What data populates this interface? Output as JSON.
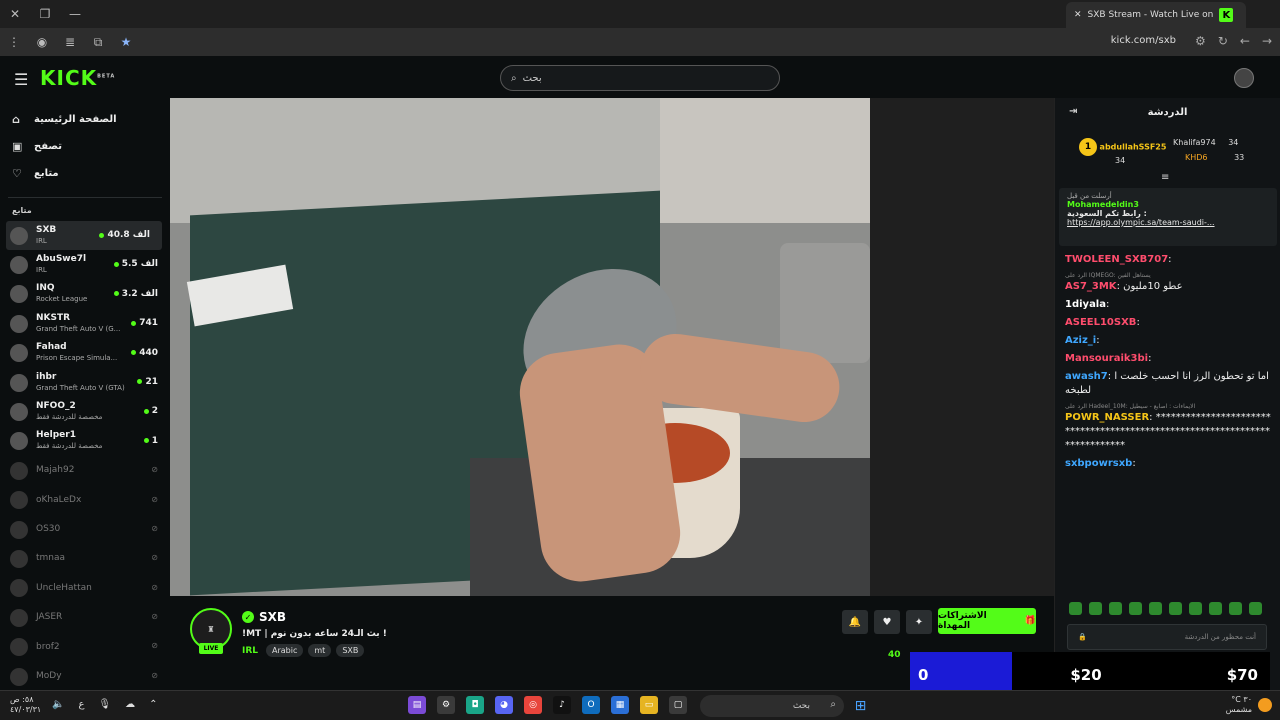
{
  "browser": {
    "tab_title": "SXB Stream - Watch Live on",
    "tab_favicon": "K",
    "url": "kick.com/sxb"
  },
  "header": {
    "logo": "KICK",
    "logo_badge": "BETA",
    "search_placeholder": "بحث"
  },
  "sidebar": {
    "nav": [
      {
        "label": "الصفحة الرئيسية",
        "icon": "home-icon"
      },
      {
        "label": "تصفح",
        "icon": "browse-icon"
      },
      {
        "label": "متابع",
        "icon": "heart-icon"
      }
    ],
    "section_title": "متابع",
    "channels": [
      {
        "name": "SXB",
        "category": "IRL",
        "viewers": "الف 40.8",
        "live": true
      },
      {
        "name": "AbuSwe7l",
        "category": "IRL",
        "viewers": "الف 5.5",
        "live": true
      },
      {
        "name": "INQ",
        "category": "Rocket League",
        "viewers": "الف 3.2",
        "live": true
      },
      {
        "name": "NKSTR",
        "category": "Grand Theft Auto V (G...",
        "viewers": "741",
        "live": true
      },
      {
        "name": "Fahad",
        "category": "Prison Escape Simula...",
        "viewers": "440",
        "live": true
      },
      {
        "name": "ihbr",
        "category": "Grand Theft Auto V (GTA)",
        "viewers": "21",
        "live": true
      },
      {
        "name": "NFOO_2",
        "category": "مخصصة للدردشة فقط",
        "viewers": "2",
        "live": true
      },
      {
        "name": "Helper1",
        "category": "مخصصة للدردشة فقط",
        "viewers": "1",
        "live": true
      },
      {
        "name": "Majah92",
        "category": "",
        "viewers": "",
        "live": false
      },
      {
        "name": "oKhaLeDx",
        "category": "",
        "viewers": "",
        "live": false
      },
      {
        "name": "OS30",
        "category": "",
        "viewers": "",
        "live": false
      },
      {
        "name": "tmnaa",
        "category": "",
        "viewers": "",
        "live": false
      },
      {
        "name": "UncleHattan",
        "category": "",
        "viewers": "",
        "live": false
      },
      {
        "name": "JASER",
        "category": "",
        "viewers": "",
        "live": false
      },
      {
        "name": "brof2",
        "category": "",
        "viewers": "",
        "live": false
      },
      {
        "name": "MoDy",
        "category": "",
        "viewers": "",
        "live": false
      }
    ]
  },
  "stream": {
    "channel": "SXB",
    "live_label": "LIVE",
    "title": "!MT | بث الـ24 ساعه بدون نوم !",
    "category": "IRL",
    "tags": [
      "Arabic",
      "mt",
      "SXB"
    ],
    "gift_button": "الاشتراكات المهداة",
    "viewer_count": "40"
  },
  "chat": {
    "title": "الدردشة",
    "leaderboard": [
      {
        "rank": "1",
        "name": "abdullahSSF25",
        "count": "34"
      },
      {
        "name": "Khalifa974",
        "count": "34"
      },
      {
        "name": "KHD6",
        "count": "33"
      }
    ],
    "pinned": {
      "label": "أرسلت من قبل",
      "user": "Mohamedeldin3",
      "text": "رابط تكم السعودية :",
      "link": "https://app.olympic.sa/team-saudi-..."
    },
    "messages": [
      {
        "user": "TWOLEEN_SXB707",
        "text": ":",
        "color": "#ff4d6d"
      },
      {
        "reply": "الرد على IQMEGO: يستاهل الفين",
        "user": "AS7_3MK",
        "text": ": عطو 10مليون",
        "color": "#ff4d6d"
      },
      {
        "user": "1diyala",
        "text": ":",
        "color": "#ffffff"
      },
      {
        "user": "ASEEL10SXB",
        "text": ":",
        "color": "#ff4d6d"
      },
      {
        "user": "Aziz_i",
        "text": ":",
        "color": "#3fa7ff"
      },
      {
        "user": "Mansouraik3bi",
        "text": ":",
        "color": "#ff4d6d"
      },
      {
        "user": "awash7",
        "text": ": اما تو تحطون الرز انا احسب خلصت الطبخه",
        "color": "#3fa7ff"
      },
      {
        "reply": "الرد على Hadeel_10M: الايماءات : اصابع - سيطيل",
        "user": "POWR_NASSER",
        "text": ": ****************************************************************************",
        "color": "#f5c518"
      },
      {
        "user": "sxbpowrsxb",
        "text": ":",
        "color": "#3fa7ff"
      }
    ],
    "input_placeholder": "أنت محظور من الدردشة"
  },
  "overlay": {
    "left": "0",
    "middle": "$20",
    "right": "$70"
  },
  "taskbar": {
    "time": "٥٨: ص",
    "date": "٤٧/٠٣/٣١",
    "lang": "ع",
    "search": "بحث",
    "temp": "°C ٣٠",
    "weather": "مشمس"
  }
}
